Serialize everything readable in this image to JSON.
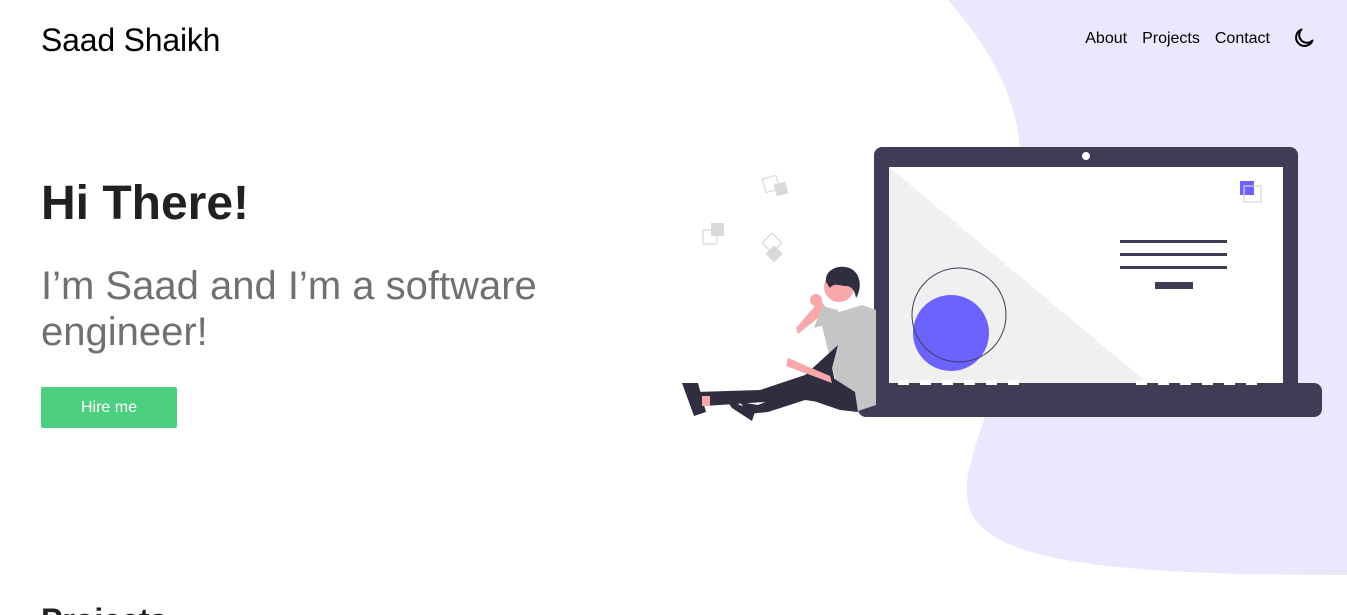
{
  "header": {
    "brand": "Saad Shaikh",
    "nav": [
      {
        "label": "About"
      },
      {
        "label": "Projects"
      },
      {
        "label": "Contact"
      }
    ],
    "theme_icon": "moon-icon"
  },
  "hero": {
    "greeting": "Hi There!",
    "subtitle": "I’m Saad and I’m a software engineer!",
    "cta_label": "Hire me",
    "illustration": "developer-illustration"
  },
  "next_section": {
    "title": "Projects"
  },
  "colors": {
    "accent": "#4cd080",
    "blob": "#e6e6fc",
    "laptop": "#3f3d56",
    "circle": "#6c63ff",
    "subtitle": "#707070"
  }
}
